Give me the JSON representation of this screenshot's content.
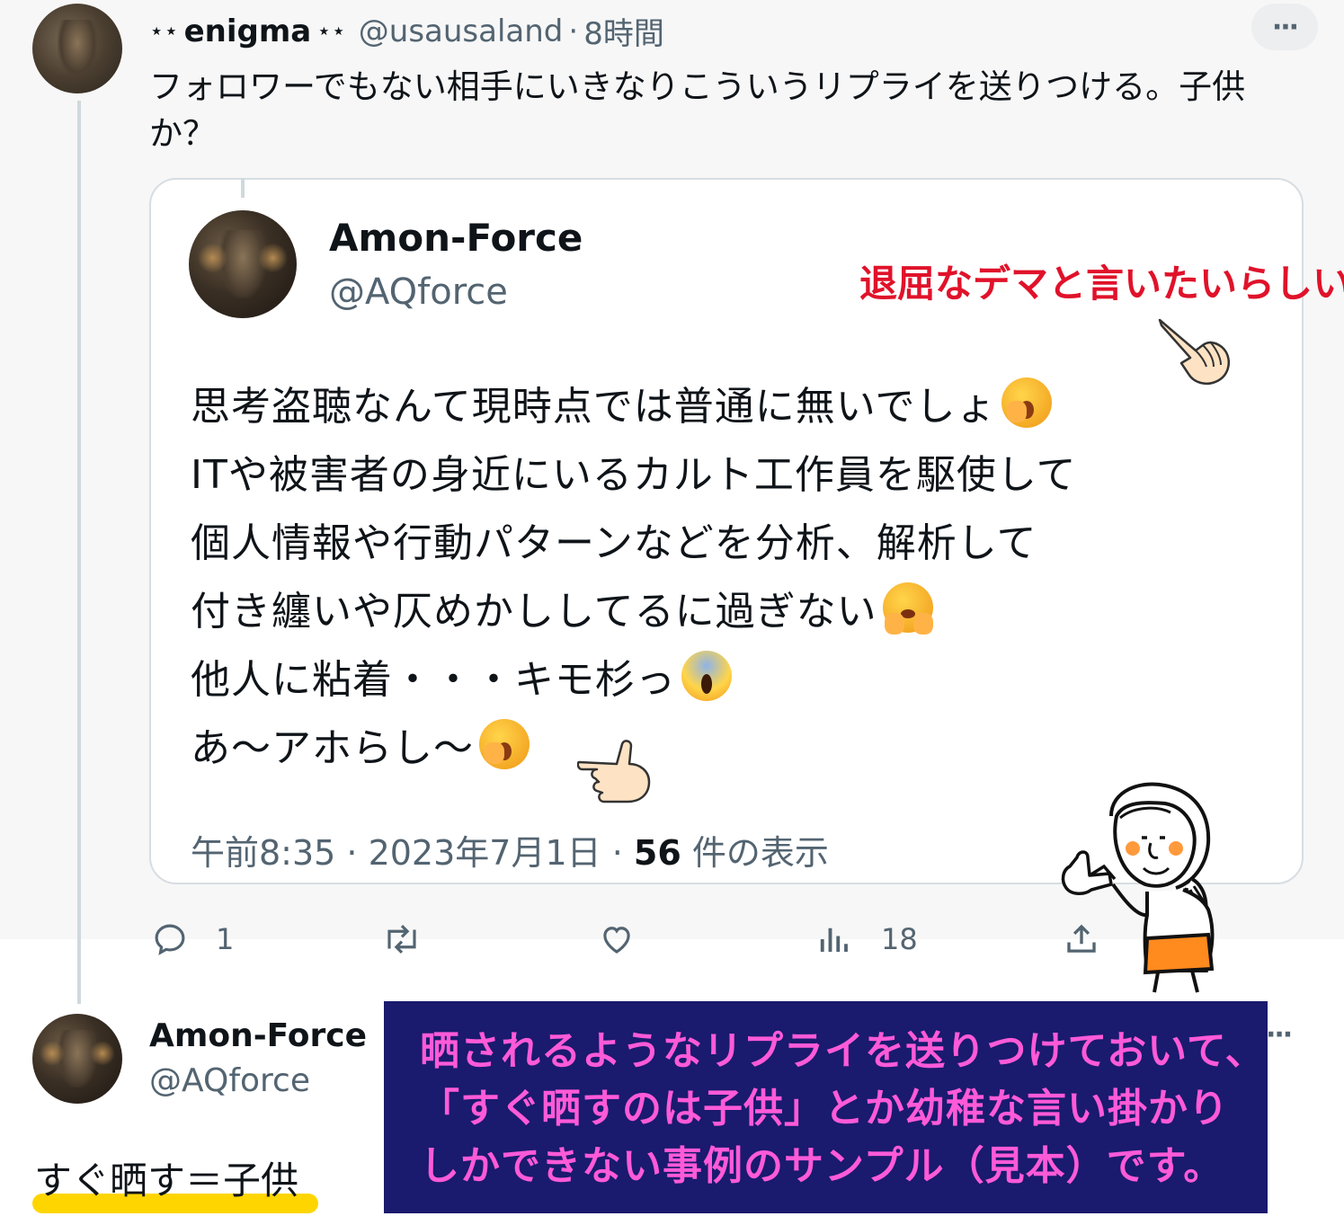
{
  "tweet": {
    "name_prefix": "⋆⋆",
    "display_name": "enigma",
    "name_suffix": "⋆⋆",
    "handle": "@usausaland",
    "separator": "·",
    "time_ago": "8時間",
    "more": "···",
    "text_line1": "フォロワーでもない相手にいきなりこういうリプライを送りつける。子供",
    "text_line2": "か？"
  },
  "quote": {
    "display_name": "Amon-Force",
    "handle": "@AQforce",
    "lines": [
      "思考盗聴なんて現時点では普通に無いでしょ",
      "ITや被害者の身近にいるカルト工作員を駆使して",
      "個人情報や行動パターンなどを分析、解析して",
      "付き纏いや仄めかししてるに過ぎない",
      "他人に粘着・・・キモ杉っ",
      "あ〜アホらし〜"
    ],
    "timestamp": "午前8:35 · 2023年7月1日 · ",
    "views_count": "56",
    "views_label": " 件の表示"
  },
  "annotations": {
    "red_note": "退屈なデマと言いたいらしい",
    "red_color": "#e0122a",
    "box_line1": "晒されるようなリプライを送りつけておいて、",
    "box_line2": "「すぐ晒すのは子供」とか幼稚な言い掛かり",
    "box_line3": "しかできない事例のサンプル（見本）です。",
    "box_bg": "#1a1a6e",
    "box_text_color": "#ff5ad8"
  },
  "actions": {
    "reply_count": "1",
    "views_count": "18"
  },
  "reply": {
    "display_name": "Amon-Force",
    "handle": "@AQforce",
    "more": "···",
    "text": "すぐ晒す＝子供"
  },
  "icons": [
    "reply-icon",
    "retweet-icon",
    "like-icon",
    "analytics-icon",
    "share-icon",
    "more-icon",
    "pointing-hand-icon",
    "yawning-face-emoji",
    "hugging-face-emoji",
    "screaming-face-emoji"
  ]
}
